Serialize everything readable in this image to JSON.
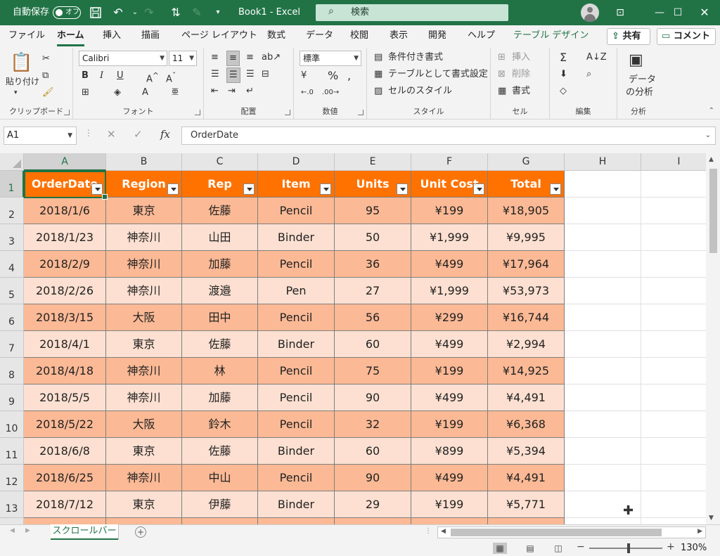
{
  "titlebar": {
    "autosave_label": "自動保存",
    "toggle_label": "オフ",
    "title": "Book1 - Excel",
    "search_placeholder": "検索"
  },
  "ribbon_tabs": [
    "ファイル",
    "ホーム",
    "挿入",
    "描画",
    "ページ レイアウト",
    "数式",
    "データ",
    "校閲",
    "表示",
    "開発",
    "ヘルプ",
    "テーブル デザイン"
  ],
  "active_tab": "ホーム",
  "share_label": "共有",
  "comment_label": "コメント",
  "ribbon": {
    "clipboard": {
      "paste": "貼り付け",
      "label": "クリップボード"
    },
    "font": {
      "name": "Calibri",
      "size": "11",
      "label": "フォント"
    },
    "alignment": {
      "label": "配置"
    },
    "number": {
      "format": "標準",
      "label": "数値"
    },
    "styles": {
      "conditional": "条件付き書式",
      "as_table": "テーブルとして書式設定",
      "cell_styles": "セルのスタイル",
      "label": "スタイル"
    },
    "cells": {
      "insert": "挿入",
      "delete": "削除",
      "format": "書式",
      "label": "セル"
    },
    "editing": {
      "label": "編集"
    },
    "analysis": {
      "button_line1": "データ",
      "button_line2": "の分析",
      "label": "分析"
    }
  },
  "formula_bar": {
    "name_box": "A1",
    "fx": "fx",
    "content": "OrderDate"
  },
  "columns": [
    "A",
    "B",
    "C",
    "D",
    "E",
    "F",
    "G",
    "H",
    "I"
  ],
  "rows": [
    "1",
    "2",
    "3",
    "4",
    "5",
    "6",
    "7",
    "8",
    "9",
    "10",
    "11",
    "12",
    "13"
  ],
  "table": {
    "headers": [
      "OrderDate",
      "Region",
      "Rep",
      "Item",
      "Units",
      "Unit Cost",
      "Total"
    ],
    "rows": [
      [
        "2018/1/6",
        "東京",
        "佐藤",
        "Pencil",
        "95",
        "¥199",
        "¥18,905"
      ],
      [
        "2018/1/23",
        "神奈川",
        "山田",
        "Binder",
        "50",
        "¥1,999",
        "¥9,995"
      ],
      [
        "2018/2/9",
        "神奈川",
        "加藤",
        "Pencil",
        "36",
        "¥499",
        "¥17,964"
      ],
      [
        "2018/2/26",
        "神奈川",
        "渡邉",
        "Pen",
        "27",
        "¥1,999",
        "¥53,973"
      ],
      [
        "2018/3/15",
        "大阪",
        "田中",
        "Pencil",
        "56",
        "¥299",
        "¥16,744"
      ],
      [
        "2018/4/1",
        "東京",
        "佐藤",
        "Binder",
        "60",
        "¥499",
        "¥2,994"
      ],
      [
        "2018/4/18",
        "神奈川",
        "林",
        "Pencil",
        "75",
        "¥199",
        "¥14,925"
      ],
      [
        "2018/5/5",
        "神奈川",
        "加藤",
        "Pencil",
        "90",
        "¥499",
        "¥4,491"
      ],
      [
        "2018/5/22",
        "大阪",
        "鈴木",
        "Pencil",
        "32",
        "¥199",
        "¥6,368"
      ],
      [
        "2018/6/8",
        "東京",
        "佐藤",
        "Binder",
        "60",
        "¥899",
        "¥5,394"
      ],
      [
        "2018/6/25",
        "神奈川",
        "中山",
        "Pencil",
        "90",
        "¥499",
        "¥4,491"
      ],
      [
        "2018/7/12",
        "東京",
        "伊藤",
        "Binder",
        "29",
        "¥199",
        "¥5,771"
      ]
    ]
  },
  "sheet_tab": "スクロールバー",
  "status": {
    "zoom": "130%"
  },
  "colors": {
    "accent": "#217346",
    "table_header": "#ff7200",
    "band_dark": "#fbb995",
    "band_light": "#fde0d1"
  }
}
